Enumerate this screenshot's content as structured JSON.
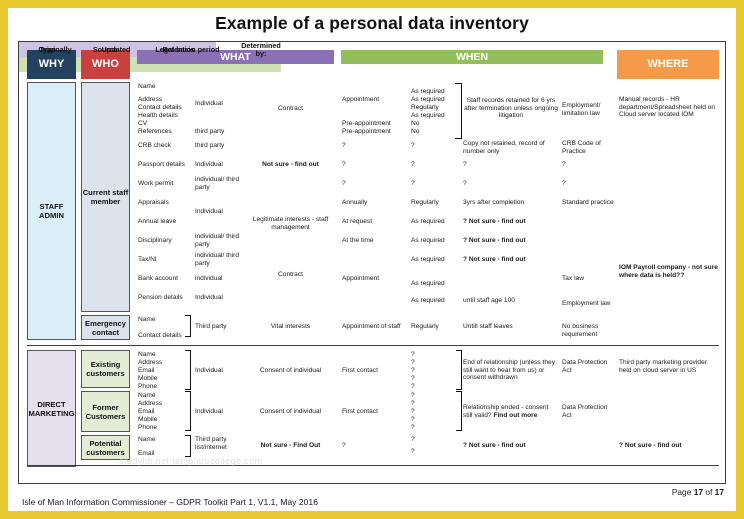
{
  "title": "Example of a personal data inventory",
  "headers": {
    "why": "WHY",
    "who": "WHO",
    "what": "WHAT",
    "when": "WHEN",
    "where": "WHERE",
    "what_sub": [
      "Type",
      "Source",
      "Legal basis"
    ],
    "when_sub": [
      "Originally",
      "Updated",
      "Retention period",
      "Determined by:"
    ]
  },
  "colors": {
    "why": "#24425f",
    "who": "#c9403f",
    "what": "#8a70b5",
    "what_sub": "#cfc3e3",
    "when": "#92bf5b",
    "when_sub": "#cfe0b2",
    "where": "#f59a48",
    "page_border": "#e8c930"
  },
  "sections": [
    {
      "why": "STAFF ADMIN",
      "who_groups": [
        {
          "who": "Current staff member"
        },
        {
          "who": "Emergency contact"
        }
      ]
    },
    {
      "why": "DIRECT MARKETING",
      "who_groups": [
        {
          "who": "Existing customers"
        },
        {
          "who": "Former Customers"
        },
        {
          "who": "Potential customers"
        }
      ]
    }
  ],
  "staff_admin": {
    "types": [
      "Name",
      "Address",
      "Contact details",
      "Health details",
      "CV",
      "References",
      "CRB check",
      "Passport details",
      "Work permit",
      "Appraisals",
      "Annual leave",
      "Disciplinary",
      "Tax/NI",
      "Bank account",
      "Pension details"
    ],
    "sources": {
      "individual_1": "Individual",
      "references": "third party",
      "crb": "third party",
      "passport": "Individual",
      "work_permit": "individual/ third party",
      "appraisals_leave": "Individual",
      "disciplinary": "individual/ third party",
      "taxni": "individual/ third party",
      "bank": "individual",
      "pension": "Individual"
    },
    "legal": {
      "contract_1": "Contract",
      "passport": "Not sure - find out",
      "legit": "Legitimate interests - staff management",
      "contract_2": "Contract"
    },
    "originally": {
      "appointment": "Appointment",
      "pre_appt_1": "Pre-appointment",
      "pre_appt_2": "Pre-appointment",
      "crb": "?",
      "passport": "?",
      "work_permit": "?",
      "appraisals": "Annually",
      "annual_leave": "At request",
      "disciplinary": "At the time",
      "bank": "Appointment"
    },
    "updated": {
      "r1": "As required",
      "r2": "As required",
      "r3": "Regularly",
      "r4": "As required",
      "r5": "No",
      "r6": "No",
      "crb": "?",
      "passport": "?",
      "work_permit": "?",
      "appraisals": "Regularly",
      "annual_leave": "As required",
      "disciplinary": "As required",
      "taxni": "As required",
      "bank": "As required",
      "pension": "As required"
    },
    "retention": {
      "staff_records": "Staff records retained for 6 yrs after termination unless ongoing litigation",
      "crb": "Copy not retained, record of number only",
      "passport": "?",
      "work_permit": "?",
      "appraisals": "3yrs after completion",
      "annual_leave": "? Not sure - find out",
      "disciplinary": "? Not sure - find out",
      "taxni": "? Not sure - find out",
      "pension": "until staff age 100"
    },
    "determined": {
      "employment": "Employment/ limitation law",
      "crb": "CRB Code of Practice",
      "passport": "?",
      "work_permit": "?",
      "appraisals": "Standard practice",
      "taxni": "Tax law",
      "pension": "Employment law"
    },
    "where": {
      "manual": "Manual records - HR department/Spreadsheet held on Cloud server located IOM",
      "payroll": "IOM Payroll company - not sure where data is held??"
    }
  },
  "emergency_contact": {
    "types": [
      "Name",
      "Contact details"
    ],
    "source": "Third party",
    "legal": "Vital interests",
    "originally": "Appointment of staff",
    "updated": "Regularly",
    "retention": "Untill staff leaves",
    "determined": "No business requirement",
    "where": ""
  },
  "direct_marketing": [
    {
      "types": [
        "Name",
        "Address",
        "Email",
        "Mobile",
        "Phone"
      ],
      "source": "Individual",
      "legal": "Consent of individual",
      "originally": "First contact",
      "updated": [
        "?",
        "?",
        "?",
        "?",
        "?"
      ],
      "retention": "End of relationship (unless they still want to hear from us) or consent withdrawn",
      "retention_bold": "",
      "determined": "Data Protection Act",
      "where": "Third party marketing provider held on cloud server in US"
    },
    {
      "types": [
        "Name",
        "Address",
        "Email",
        "Mobile",
        "Phone"
      ],
      "source": "Individual",
      "legal": "Consent of individual",
      "originally": "First contact",
      "updated": [
        "?",
        "?",
        "?",
        "?",
        "?"
      ],
      "retention": "Relationship ended - consent still valid?",
      "retention_bold": "Find out more",
      "determined": "Data Protection Act",
      "where": ""
    },
    {
      "types": [
        "Name",
        "Email"
      ],
      "source": "Third party list/internet",
      "legal": "Not sure - Find Out",
      "originally": "?",
      "updated": [
        "?",
        "?"
      ],
      "retention": "? Not sure - find out",
      "retention_bold": "",
      "determined": "",
      "where": "? Not sure - find out"
    }
  ],
  "footer": {
    "page_label_pre": "Page ",
    "page_current": "17",
    "page_mid": " of ",
    "page_total": "17",
    "source_line": "Isle of Man Information Commissioner – GDPR Toolkit Part 1, V1.1, May 2016"
  }
}
